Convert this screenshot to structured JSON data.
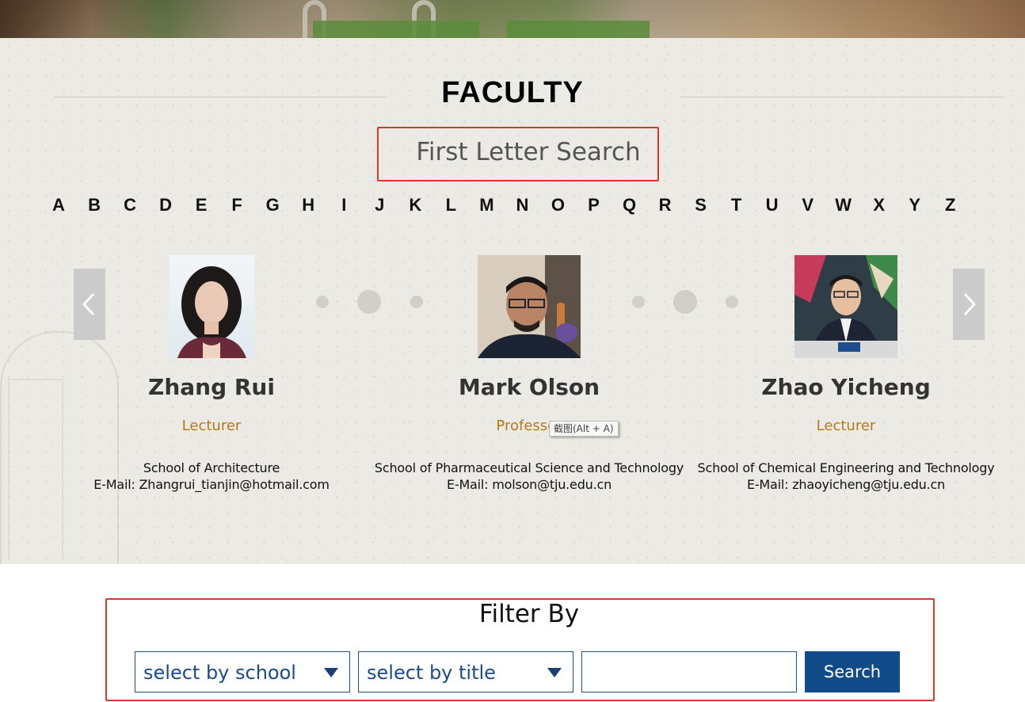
{
  "section": {
    "title": "FACULTY",
    "letter_search_title": "First Letter Search",
    "letters": [
      "A",
      "B",
      "C",
      "D",
      "E",
      "F",
      "G",
      "H",
      "I",
      "J",
      "K",
      "L",
      "M",
      "N",
      "O",
      "P",
      "Q",
      "R",
      "S",
      "T",
      "U",
      "V",
      "W",
      "X",
      "Y",
      "Z"
    ]
  },
  "carousel": {
    "prev_icon": "chevron-left-icon",
    "next_icon": "chevron-right-icon",
    "cards": [
      {
        "name": "Zhang Rui",
        "title": "Lecturer",
        "school": "School of Architecture",
        "email": "E-Mail: Zhangrui_tianjin@hotmail.com"
      },
      {
        "name": "Mark Olson",
        "title": "Professor",
        "school": "School of Pharmaceutical Science and Technology",
        "email": "E-Mail: molson@tju.edu.cn"
      },
      {
        "name": "Zhao Yicheng",
        "title": "Lecturer",
        "school": "School of Chemical Engineering and Technology",
        "email": "E-Mail: zhaoyicheng@tju.edu.cn"
      }
    ]
  },
  "tooltip": {
    "text": "截图(Alt + A)"
  },
  "filter": {
    "title": "Filter By",
    "school_select": "select by school",
    "title_select": "select by title",
    "keyword_value": "",
    "search_label": "Search"
  },
  "colors": {
    "highlight_border": "#e0352b",
    "title_gold": "#b5791a",
    "brand_blue": "#114b8a"
  }
}
